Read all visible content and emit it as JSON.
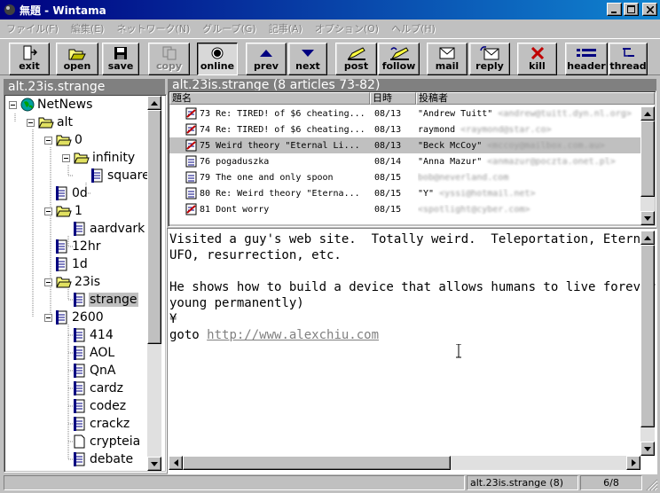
{
  "window": {
    "title": "無題 - Wintama"
  },
  "menu": [
    "ファイル(F)",
    "編集(E)",
    "ネットワーク(N)",
    "グループ(G)",
    "記事(A)",
    "オプション(O)",
    "ヘルプ(H)"
  ],
  "toolbar": {
    "exit": "exit",
    "open": "open",
    "save": "save",
    "copy": "copy",
    "online": "online",
    "prev": "prev",
    "next": "next",
    "post": "post",
    "follow": "follow",
    "mail": "mail",
    "reply": "reply",
    "kill": "kill",
    "header": "header",
    "thread": "thread"
  },
  "tree": {
    "group_label": "alt.23is.strange",
    "root": "NetNews",
    "alt": "alt",
    "n0": "0",
    "infinity": "infinity",
    "squared": "squared",
    "n0d": "0d",
    "n1": "1",
    "aardvark": "aardvark",
    "n12hr": "12hr",
    "n1d": "1d",
    "n23is": "23is",
    "strange": "strange",
    "n2600": "2600",
    "n414": "414",
    "aol": "AOL",
    "qna": "QnA",
    "cardz": "cardz",
    "codez": "codez",
    "crackz": "crackz",
    "crypteia": "crypteia",
    "debate": "debate"
  },
  "articles": {
    "header_label": "alt.23is.strange (8 articles  73-82)",
    "columns": {
      "subject": "題名",
      "date": "日時",
      "author": "投稿者"
    },
    "rows": [
      {
        "num": "73",
        "subject": "Re: TIRED! of $6 cheating...",
        "date": "08/13",
        "author": "\"Andrew Tuitt\"",
        "email": "<andrew@tuitt.dyn.nl.org>"
      },
      {
        "num": "74",
        "subject": "Re: TIRED! of $6 cheating...",
        "date": "08/13",
        "author": "raymond",
        "email": "<raymond@star.co>"
      },
      {
        "num": "75",
        "subject": "Weird theory  \"Eternal Li...",
        "date": "08/13",
        "author": "\"Beck McCoy\"",
        "email": "<mccoy@mailbox.com.au>"
      },
      {
        "num": "76",
        "subject": "pogaduszka",
        "date": "08/14",
        "author": "\"Anna Mazur\"",
        "email": "<anmazur@poczta.onet.pl>"
      },
      {
        "num": "79",
        "subject": "The one and only spoon",
        "date": "08/15",
        "author": "",
        "email": "bob@neverland.com"
      },
      {
        "num": "80",
        "subject": "Re: Weird theory  \"Eterna...",
        "date": "08/15",
        "author": "\"Y\"",
        "email": "<yssi@hotmail.net>"
      },
      {
        "num": "81",
        "subject": "Dont worry",
        "date": "08/15",
        "author": "",
        "email": "<spotlight@cyber.com>"
      }
    ]
  },
  "message": {
    "line1": "Visited a guy's web site.  Totally weird.  Teleportation, Eternal Li",
    "line2": "UFO, resurrection, etc.",
    "line3": "He shows how to build a device that allows humans to live forever.",
    "line4": "young permanently)",
    "line5": "¥",
    "goto": "goto ",
    "url": "http://www.alexchiu.com"
  },
  "status": {
    "group": "alt.23is.strange (8)",
    "position": "6/8"
  }
}
